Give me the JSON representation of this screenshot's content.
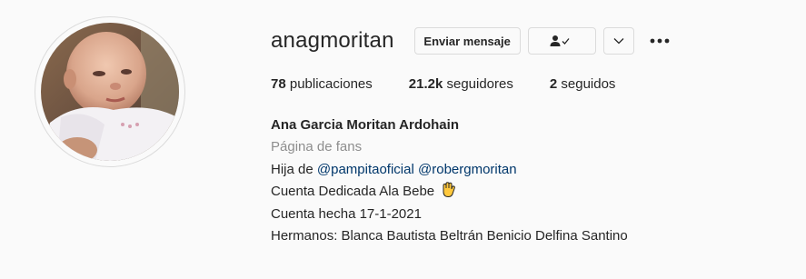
{
  "profile": {
    "username": "anagmoritan",
    "avatar_icon": "baby-photo"
  },
  "header": {
    "message_label": "Enviar mensaje",
    "following_icon": "person-check-icon",
    "more_suggestions_icon": "chevron-down-icon",
    "options_icon": "more-dots-icon"
  },
  "stats": {
    "posts_count": "78",
    "posts_label": "publicaciones",
    "followers_count": "21.2k",
    "followers_label": "seguidores",
    "following_count": "2",
    "following_label": "seguidos"
  },
  "bio": {
    "full_name": "Ana Garcia Moritan Ardohain",
    "category": "Página de fans",
    "line1_prefix": "Hija de",
    "mention1": "@pampitaoficial",
    "mention2": "@robergmoritan",
    "line2": "Cuenta Dedicada Ala Bebe",
    "line2_emoji": "raised-hands-emoji",
    "line3": "Cuenta hecha 17-1-2021",
    "line4": "Hermanos: Blanca Bautista Beltrán Benicio Delfina Santino"
  },
  "colors": {
    "background": "#fafafa",
    "text": "#262626",
    "secondary_text": "#8e8e8e",
    "link": "#00376b",
    "border": "#dbdbdb"
  }
}
